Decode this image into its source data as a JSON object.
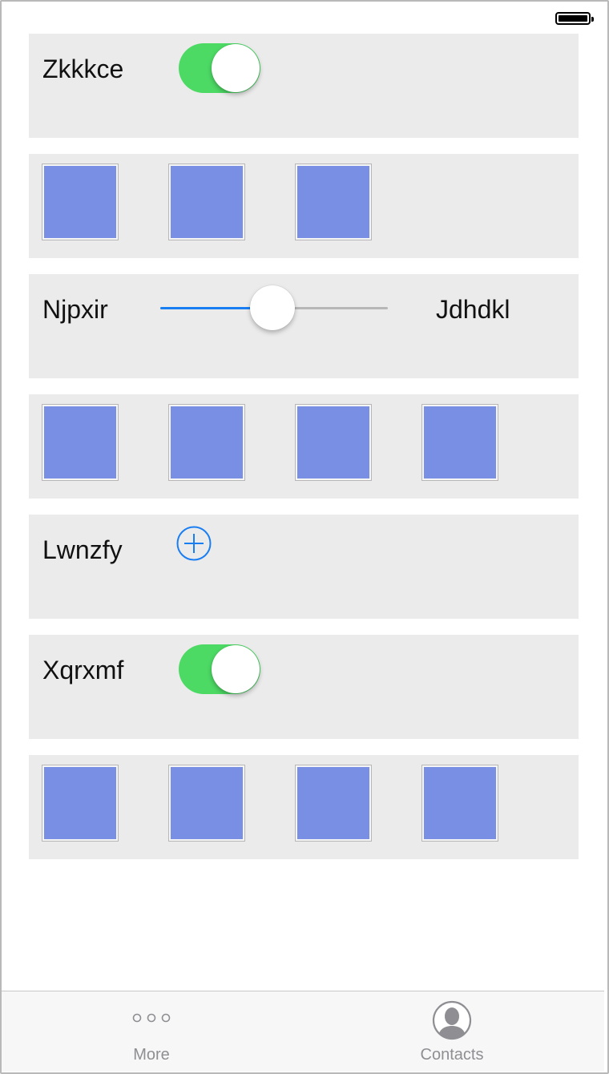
{
  "status_bar": {
    "battery_icon": "battery-full-icon"
  },
  "rows": [
    {
      "type": "toggle",
      "label": "Zkkkce",
      "toggle_on": true,
      "toggle_color": "#4cd964"
    },
    {
      "type": "image-strip",
      "image_count": 3,
      "image_color": "#788fe4"
    },
    {
      "type": "slider",
      "label": "Njpxir",
      "value_label": "Jdhdkl",
      "value_fraction": 0.5,
      "track_fill_color": "#1a7ef3"
    },
    {
      "type": "image-strip",
      "image_count": 4,
      "image_color": "#788fe4"
    },
    {
      "type": "add",
      "label": "Lwnzfy",
      "icon": "add-circle-icon",
      "icon_color": "#1a7ef3"
    },
    {
      "type": "toggle",
      "label": "Xqrxmf",
      "toggle_on": true,
      "toggle_color": "#4cd964"
    },
    {
      "type": "image-strip",
      "image_count": 4,
      "image_color": "#788fe4"
    }
  ],
  "tab_bar": {
    "items": [
      {
        "label": "More",
        "icon": "more-dots-icon"
      },
      {
        "label": "Contacts",
        "icon": "contacts-avatar-icon"
      }
    ]
  }
}
